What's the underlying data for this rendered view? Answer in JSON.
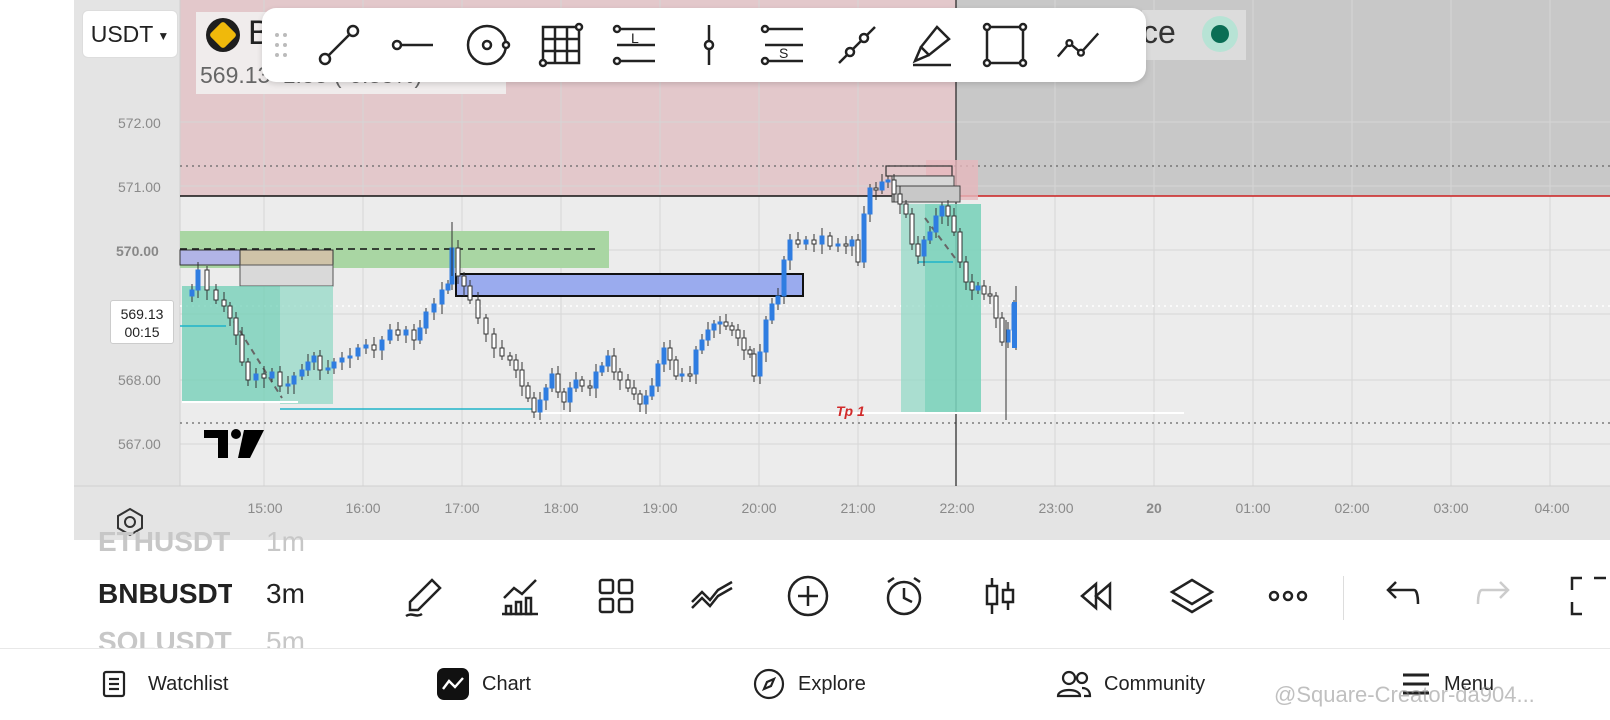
{
  "header": {
    "currency": "USDT",
    "symbol_letter": "B",
    "price_display": "569.13",
    "price_change_display": "1.53 (-0.35%)",
    "right_text": "ce"
  },
  "toolbar": {
    "icons": [
      "trend-line-icon",
      "horizontal-ray-icon",
      "circle-icon",
      "grid-icon",
      "long-position-icon",
      "vertical-line-icon",
      "short-position-icon",
      "parallel-channel-icon",
      "highlighter-icon",
      "rectangle-icon",
      "path-icon"
    ]
  },
  "chart": {
    "price_labels": [
      "572.00",
      "571.00",
      "570.00",
      "568.00",
      "567.00"
    ],
    "bold_price_label": "570.00",
    "current_price": "569.13",
    "countdown": "00:15",
    "time_labels": [
      "15:00",
      "16:00",
      "17:00",
      "18:00",
      "19:00",
      "20:00",
      "21:00",
      "22:00",
      "23:00",
      "20",
      "01:00",
      "02:00",
      "03:00",
      "04:00"
    ],
    "tp_label": "Tp 1",
    "colors": {
      "up": "#2f7de1",
      "down": "#4d4d4d",
      "tp": "#d12b2b",
      "resistance": "#cc1f1f"
    }
  },
  "intervals": {
    "rows": [
      {
        "symbol": "ETHUSDT",
        "interval": "1m",
        "faded": true
      },
      {
        "symbol": "BNBUSDT",
        "interval": "3m",
        "faded": false
      },
      {
        "symbol": "SOLUSDT",
        "interval": "5m",
        "faded": true
      }
    ]
  },
  "bottom_toolbar": {
    "icons": [
      "pencil-icon",
      "indicators-icon",
      "grid-layout-icon",
      "compare-icon",
      "add-icon",
      "alarm-icon",
      "candles-icon",
      "replay-icon",
      "layers-icon",
      "more-icon",
      "undo-icon",
      "redo-icon",
      "fullscreen-icon"
    ]
  },
  "nav": {
    "watchlist": "Watchlist",
    "chart": "Chart",
    "explore": "Explore",
    "community": "Community",
    "menu": "Menu"
  },
  "watermark": "@Square-Creator-da904..."
}
